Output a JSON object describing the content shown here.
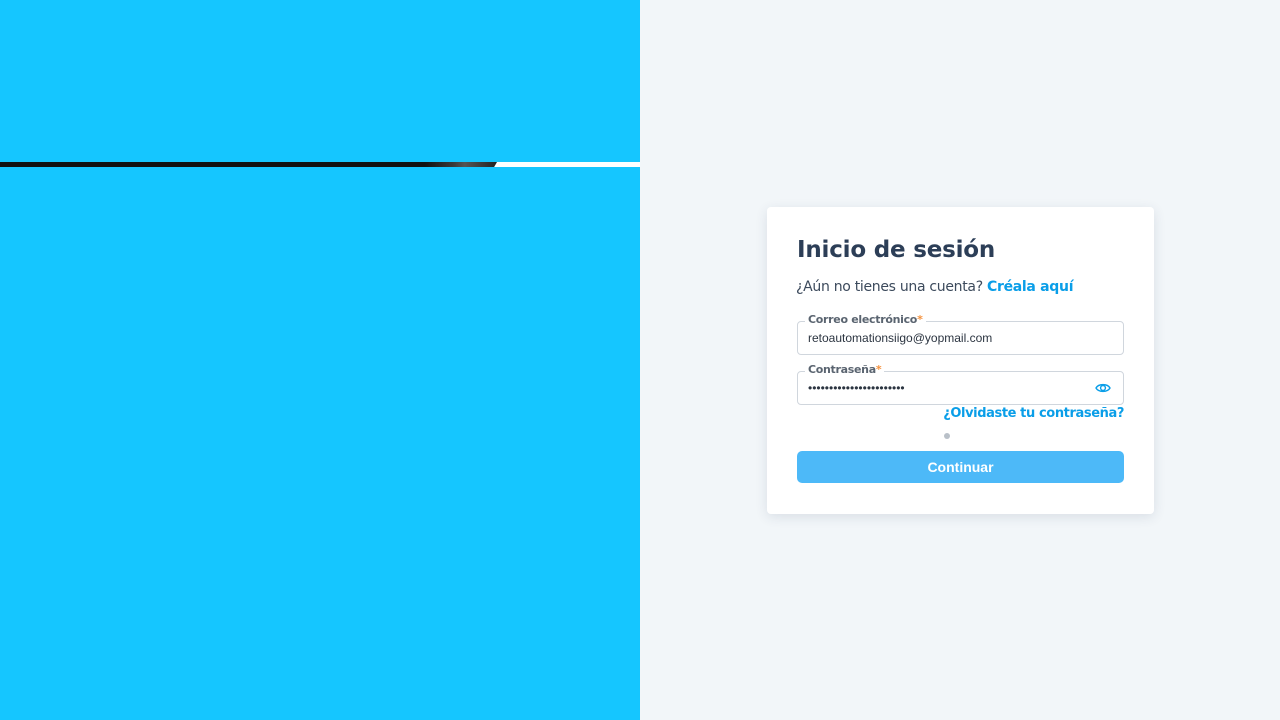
{
  "login": {
    "title": "Inicio de sesión",
    "signup_prompt": "¿Aún no tienes una cuenta?",
    "signup_link": "Créala aquí",
    "email": {
      "label": "Correo electrónico",
      "required_mark": "*",
      "value": "retoautomationsiigo@yopmail.com"
    },
    "password": {
      "label": "Contraseña",
      "required_mark": "*",
      "value": "•••••••••••••••••••••••",
      "toggle_icon": "eye-icon"
    },
    "forgot_link": "¿Olvidaste tu contraseña?",
    "continue_label": "Continuar"
  },
  "colors": {
    "left_panel": "#15c6ff",
    "accent": "#0a9ee8",
    "button": "#4db9f8",
    "required": "#f5923e"
  }
}
